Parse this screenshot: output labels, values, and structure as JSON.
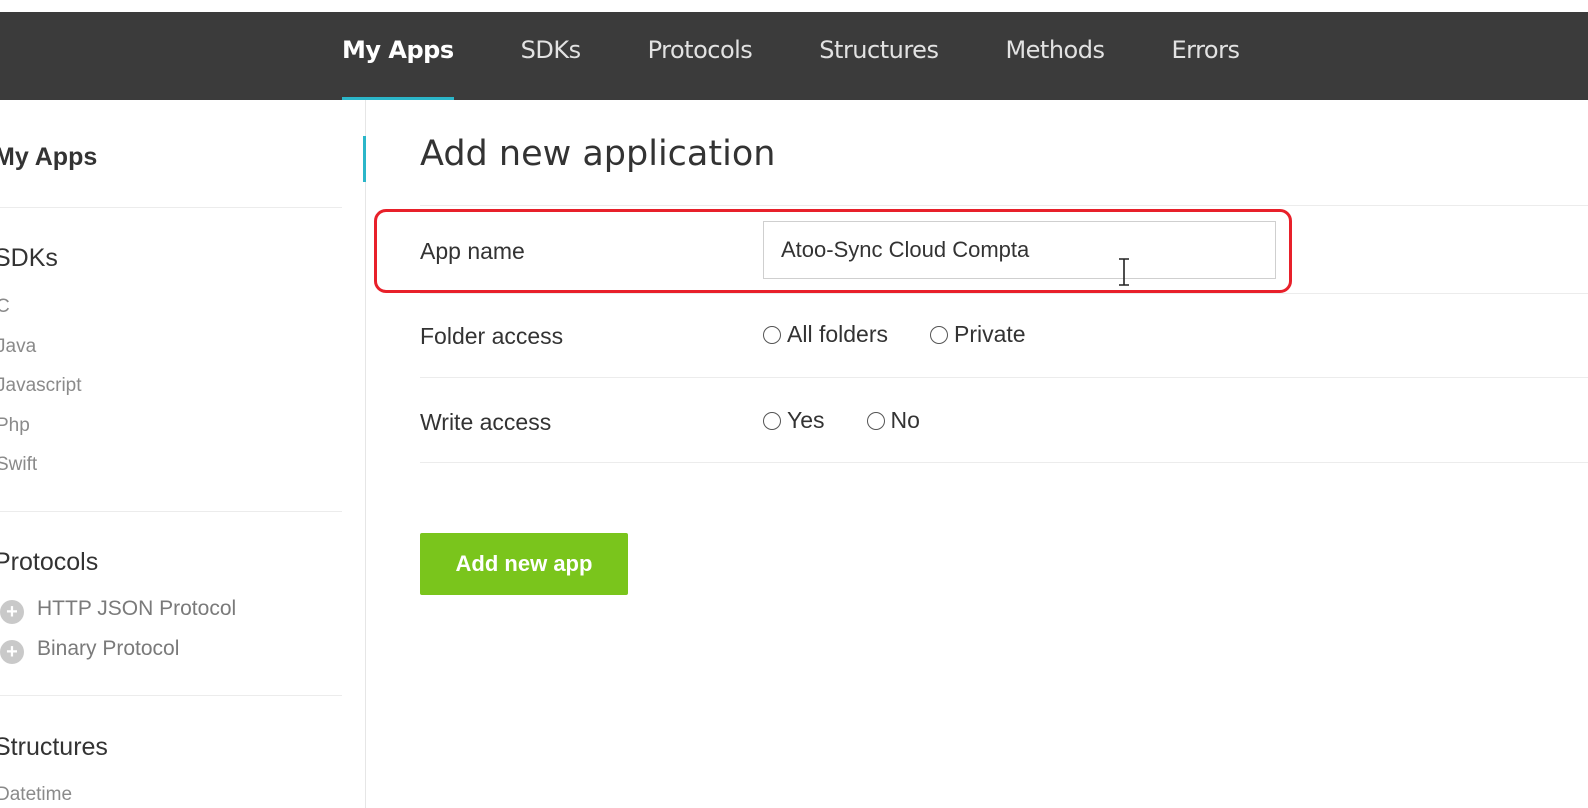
{
  "topnav": {
    "items": [
      {
        "label": "My Apps",
        "active": true
      },
      {
        "label": "SDKs"
      },
      {
        "label": "Protocols"
      },
      {
        "label": "Structures"
      },
      {
        "label": "Methods"
      },
      {
        "label": "Errors"
      }
    ]
  },
  "sidebar": {
    "my_apps": "My Apps",
    "sdks_title": "SDKs",
    "sdks": [
      "C",
      "Java",
      "Javascript",
      "Php",
      "Swift"
    ],
    "protocols_title": "Protocols",
    "protocols": [
      "HTTP JSON Protocol",
      "Binary Protocol"
    ],
    "structures_title": "Structures",
    "structures": [
      "Datetime"
    ]
  },
  "main": {
    "title": "Add new application",
    "app_name_label": "App name",
    "app_name_value": "Atoo-Sync Cloud Compta",
    "folder_access_label": "Folder access",
    "folder_options": [
      "All folders",
      "Private"
    ],
    "write_access_label": "Write access",
    "write_options": [
      "Yes",
      "No"
    ],
    "submit_label": "Add new app"
  },
  "colors": {
    "topbar_bg": "#3b3b3b",
    "accent": "#2bb6c9",
    "button_green": "#7ac51c",
    "highlight_red": "#e8202a"
  }
}
